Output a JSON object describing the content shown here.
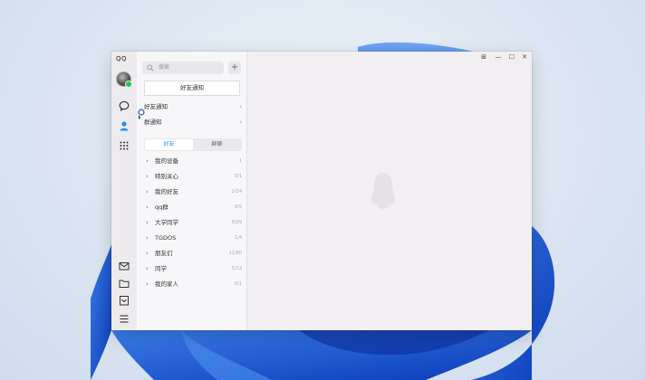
{
  "app": {
    "logo": "QQ",
    "brand_color": "#2c8cf0",
    "online_color": "#21c45b"
  },
  "rail": {
    "top_icons": [
      "chat-bubble-icon",
      "contacts-person-icon",
      "apps-grid-icon"
    ],
    "bottom_icons": [
      "mail-icon",
      "folder-icon",
      "favorites-icon",
      "menu-icon"
    ]
  },
  "contacts": {
    "search_placeholder": "搜索",
    "add_label": "+",
    "notify_button": "好友通知",
    "friend_requests_label": "好友通知",
    "groups_label": "群通知",
    "tabs": [
      {
        "label": "好友",
        "active": true
      },
      {
        "label": "群聊",
        "active": false
      }
    ],
    "friend_groups": [
      {
        "name": "我的设备",
        "count": "1"
      },
      {
        "name": "特别关心",
        "count": "0/1"
      },
      {
        "name": "我的好友",
        "count": "2/24"
      },
      {
        "name": "qq群",
        "count": "0/5"
      },
      {
        "name": "大学同学",
        "count": "5/29"
      },
      {
        "name": "TGDOS",
        "count": "1/4"
      },
      {
        "name": "朋友们",
        "count": "12/80"
      },
      {
        "name": "同学",
        "count": "5/13"
      },
      {
        "name": "我的家人",
        "count": "0/1"
      }
    ]
  },
  "window_controls": [
    "pin-icon",
    "minimize-icon",
    "maximize-icon",
    "close-icon"
  ],
  "window_control_glyphs": {
    "pin": "⊞",
    "minimize": "—",
    "maximize": "☐",
    "close": "✕"
  }
}
